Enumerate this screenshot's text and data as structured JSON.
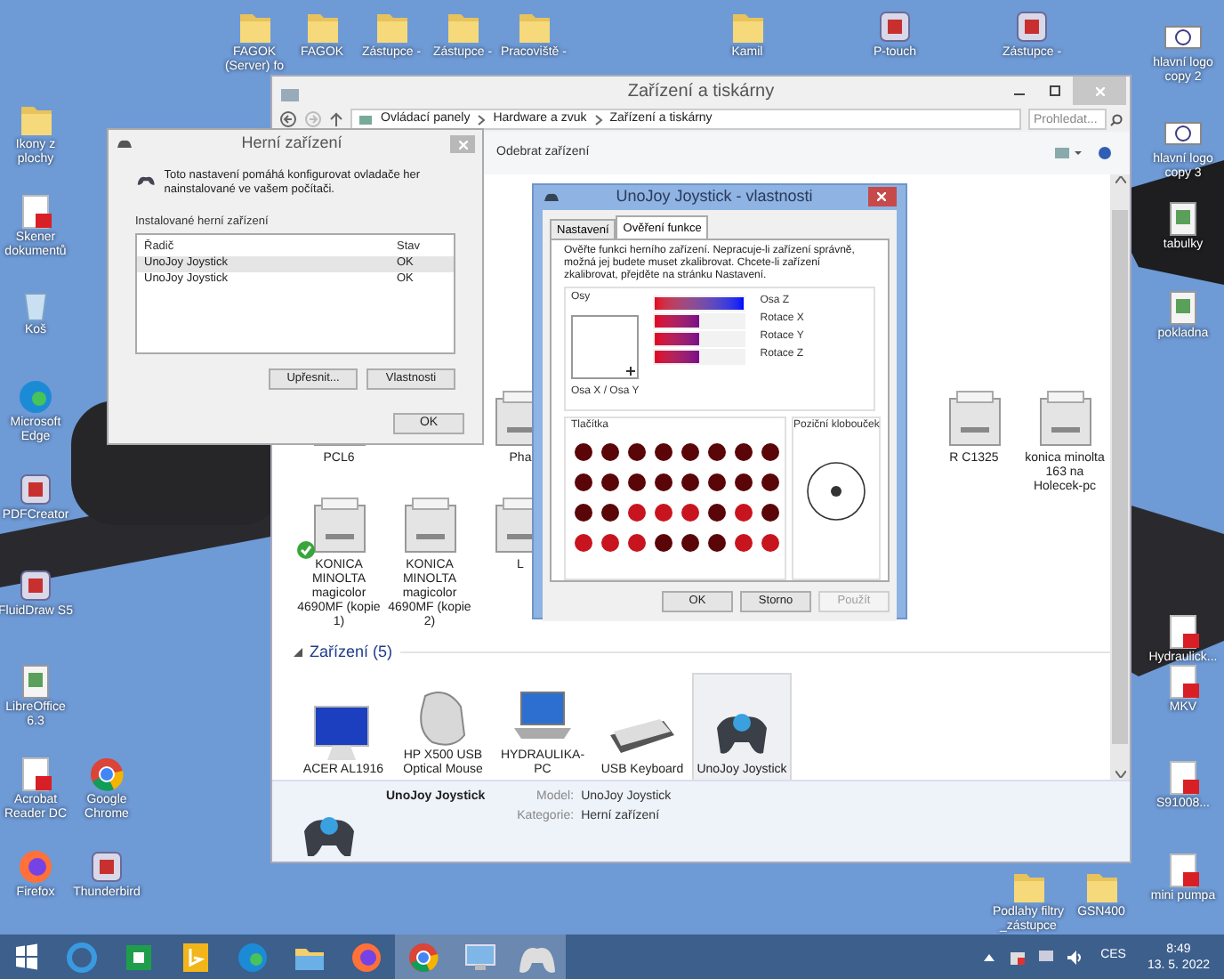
{
  "desktop_icons": [
    {
      "label": "FAGOK (Server) fo"
    },
    {
      "label": "FAGOK"
    },
    {
      "label": "Zástupce -"
    },
    {
      "label": "Zástupce -"
    },
    {
      "label": "Pracoviště -"
    },
    {
      "label": "Kamil"
    },
    {
      "label": "P-touch"
    },
    {
      "label": "Zástupce -"
    },
    {
      "label": "Ikony z plochy"
    },
    {
      "label": "Skener dokumentů"
    },
    {
      "label": "Koš"
    },
    {
      "label": "Microsoft Edge"
    },
    {
      "label": "PDFCreator"
    },
    {
      "label": "FluidDraw S5"
    },
    {
      "label": "LibreOffice 6.3"
    },
    {
      "label": "Acrobat Reader DC"
    },
    {
      "label": "Google Chrome"
    },
    {
      "label": "Firefox"
    },
    {
      "label": "Thunderbird"
    },
    {
      "label": "hlavní logo copy 2"
    },
    {
      "label": "hlavní logo copy 3"
    },
    {
      "label": "tabulky"
    },
    {
      "label": "pokladna"
    },
    {
      "label": "Hydraulick..."
    },
    {
      "label": "MKV"
    },
    {
      "label": "S91008..."
    },
    {
      "label": "Podlahy filtry _zástupce"
    },
    {
      "label": "GSN400"
    },
    {
      "label": "mini pumpa"
    }
  ],
  "devices_window": {
    "title": "Zařízení a tiskárny",
    "breadcrumb": [
      "Ovládací panely",
      "Hardware a zvuk",
      "Zařízení a tiskárny"
    ],
    "search": {
      "placeholder": "Prohledat..."
    },
    "toolbar": [
      "Odebrat zařízení"
    ],
    "printers": [
      {
        "label": "PCL6",
        "default": false
      },
      {
        "label": "Pha",
        "default": false
      },
      {
        "label": "R C1325",
        "default": false
      },
      {
        "label": "konica minolta 163 na Holecek-pc",
        "default": false
      },
      {
        "label": "KONICA MINOLTA magicolor 4690MF (kopie 1)",
        "default": true
      },
      {
        "label": "KONICA MINOLTA magicolor 4690MF (kopie 2)",
        "default": false
      },
      {
        "label": "L",
        "default": false
      }
    ],
    "devices_group": "Zařízení (5)",
    "devices": [
      {
        "label": "ACER AL1916",
        "selected": false
      },
      {
        "label": "HP X500 USB Optical Mouse",
        "selected": false
      },
      {
        "label": "HYDRAULIKA-PC",
        "selected": false
      },
      {
        "label": "USB Keyboard",
        "selected": false
      },
      {
        "label": "UnoJoy Joystick",
        "selected": true
      }
    ],
    "details": {
      "name": "UnoJoy Joystick",
      "fields": [
        {
          "label": "Model:",
          "value": "UnoJoy Joystick"
        },
        {
          "label": "Kategorie:",
          "value": "Herní zařízení"
        }
      ]
    }
  },
  "game_controllers_dialog": {
    "title": "Herní zařízení",
    "description": "Toto nastavení pomáhá konfigurovat ovladače her nainstalované ve vašem počítači.",
    "group": "Instalované herní zařízení",
    "columns": [
      "Řadič",
      "Stav"
    ],
    "rows": [
      {
        "cells": [
          "UnoJoy Joystick",
          "OK"
        ],
        "selected": true
      },
      {
        "cells": [
          "UnoJoy Joystick",
          "OK"
        ],
        "selected": false
      }
    ],
    "buttons": [
      "Upřesnit...",
      "Vlastnosti"
    ],
    "ok": "OK"
  },
  "properties_dialog": {
    "title": "UnoJoy Joystick - vlastnosti",
    "tabs": [
      {
        "label": "Nastavení",
        "selected": false
      },
      {
        "label": "Ověření funkce",
        "selected": true
      }
    ],
    "description": "Ověřte funkci herního zařízení. Nepracuje-li zařízení správně, možná jej budete muset zkalibrovat. Chcete-li zařízení zkalibrovat, přejděte na stránku Nastavení.",
    "axes_group": "Osy",
    "xy_label": "Osa X / Osa Y",
    "axes": [
      {
        "name": "Osa Z",
        "level": 1.0
      },
      {
        "name": "Rotace X",
        "level": 0.5
      },
      {
        "name": "Rotace Y",
        "level": 0.5
      },
      {
        "name": "Rotace Z",
        "level": 0.5
      }
    ],
    "buttons_group": "Tlačítka",
    "buttons": [
      {
        "pressed": false
      },
      {
        "pressed": false
      },
      {
        "pressed": false
      },
      {
        "pressed": false
      },
      {
        "pressed": false
      },
      {
        "pressed": false
      },
      {
        "pressed": false
      },
      {
        "pressed": false
      },
      {
        "pressed": false
      },
      {
        "pressed": false
      },
      {
        "pressed": false
      },
      {
        "pressed": false
      },
      {
        "pressed": false
      },
      {
        "pressed": false
      },
      {
        "pressed": false
      },
      {
        "pressed": false
      },
      {
        "pressed": false
      },
      {
        "pressed": false
      },
      {
        "pressed": true
      },
      {
        "pressed": true
      },
      {
        "pressed": true
      },
      {
        "pressed": false
      },
      {
        "pressed": true
      },
      {
        "pressed": false
      },
      {
        "pressed": true
      },
      {
        "pressed": true
      },
      {
        "pressed": true
      },
      {
        "pressed": false
      },
      {
        "pressed": false
      },
      {
        "pressed": false
      },
      {
        "pressed": true
      },
      {
        "pressed": true
      }
    ],
    "hat_group": "Poziční klobouček",
    "actions": [
      {
        "label": "OK",
        "disabled": false
      },
      {
        "label": "Storno",
        "disabled": false
      },
      {
        "label": "Použít",
        "disabled": true
      }
    ]
  },
  "taskbar": {
    "apps": [
      {
        "active": false
      },
      {
        "active": false
      },
      {
        "active": false
      },
      {
        "active": false
      },
      {
        "active": false
      },
      {
        "active": false
      },
      {
        "active": true
      },
      {
        "active": true
      },
      {
        "active": true
      }
    ],
    "language": "CES",
    "time": "8:49",
    "date": "13. 5. 2022"
  }
}
